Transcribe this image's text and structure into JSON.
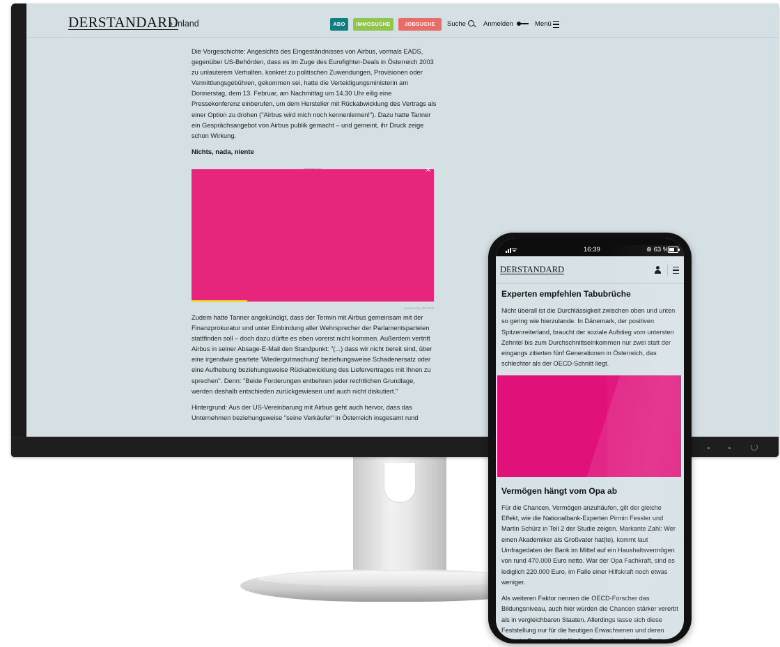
{
  "desktop": {
    "header": {
      "logo": "DERSTANDARD",
      "breadcrumb": "› Inland",
      "buttons": {
        "abo": "ABO",
        "immo": "IMMOSUCHE",
        "job": "JOBSUCHE"
      },
      "nav": {
        "suche": "Suche",
        "anmelden": "Anmelden",
        "menu": "Menü"
      }
    },
    "article": {
      "para1": "Die Vorgeschichte: Angesichts des Eingeständnisses von Airbus, vormals EADS, gegenüber US-Behörden, dass es im Zuge des Eurofighter-Deals in Österreich 2003 zu unlauterem Verhalten, konkret zu politischen Zuwendungen, Provisionen oder Vermittlungsgebühren, gekommen sei, hatte die Verteidigungsministerin am Donnerstag, dem 13. Februar, am Nachmittag um 14.30 Uhr eilig eine Pressekonferenz einberufen, um dem Hersteller mit Rückabwicklung des Vertrags als einer Option zu drohen (\"Airbus wird mich noch kennenlernen!\"). Dazu hatte Tanner ein Gesprächsangebot von Airbus publik gemacht – und gemeint, ihr Druck zeige schon Wirkung.",
      "heading": "Nichts, nada, niente",
      "ad_label": "WERBUNG",
      "ad_close": "×",
      "ad_footer": "powered by ADITION",
      "para2": "Zudem hatte Tanner angekündigt, dass der Termin mit Airbus gemeinsam mit der Finanzprokuratur und unter Einbindung aller Wehrsprecher der Parlamentsparteien stattfinden soll – doch dazu dürfte es eben vorerst nicht kommen. Außerdem vertritt Airbus in seiner Absage-E-Mail den Standpunkt: \"(...) dass wir nicht bereit sind, über eine irgendwie geartete 'Wiedergutmachung' beziehungsweise Schadenersatz oder eine Aufhebung beziehungsweise Rückabwicklung des Liefervertrages mit Ihnen zu sprechen\". Denn: \"Beide Forderungen entbehren jeder rechtlichen Grundlage, werden deshalb entschieden zurückgewiesen und auch nicht diskutiert.\"",
      "para3": "Hintergrund: Aus der US-Vereinbarung mit Airbus geht auch hervor, dass das Unternehmen beziehungsweise \"seine Verkäufer\" in Österreich insgesamt rund"
    }
  },
  "phone": {
    "status": {
      "time": "16:39",
      "battery": "⊕ 63 %",
      "wifi": "ᯤ"
    },
    "logo": "DERSTANDARD",
    "article": {
      "heading1": "Experten empfehlen Tabubrüche",
      "para1": "Nicht überall ist die Durchlässigkeit zwischen oben und unten so gering wie hierzulande. In Dänemark, der positiven Spitzenreiterland, braucht der soziale Aufstieg vom untersten Zehntel bis zum Durchschnittseinkommen nur zwei statt der eingangs zitierten fünf Generationen in Österreich, das schlechter als der OECD-Schnitt liegt.",
      "heading2": "Vermögen hängt vom Opa ab",
      "para2": "Für die Chancen, Vermögen anzuhäufen, gilt der gleiche Effekt, wie die Nationalbank-Experten Pirmin Fessler und Martin Schürz in Teil 2 der Studie zeigen. Markante Zahl: Wer einen Akademiker als Großvater hat(te), kommt laut Umfragedaten der Bank im Mittel auf ein Haushaltsvermögen von rund 470.000 Euro netto. War der Opa Fachkraft, sind es lediglich 220.000 Euro, im Falle einer Hilfskraft noch etwas weniger.",
      "para3": "Als weiteren Faktor nennen die OECD-Forscher das Bildungsniveau, auch hier würden die Chancen stärker vererbt als in vergleichbaren Staaten. Allerdings lasse sich diese Feststellung nur für die heutigen Erwachsenen und deren Eltern treffen und nicht für das System im aktuellen Zustand, so die Einschränkung. Außerdem ist die Expertise"
    }
  },
  "colors": {
    "abo": "#137e80",
    "immo": "#8fc64b",
    "job": "#e86d68",
    "ad": "#e8257c",
    "site_bg": "#d5e0e5"
  },
  "icons": [
    "search-icon",
    "key-icon",
    "menu-icon",
    "user-icon",
    "close-icon",
    "wifi-icon",
    "battery-icon",
    "power-icon"
  ]
}
